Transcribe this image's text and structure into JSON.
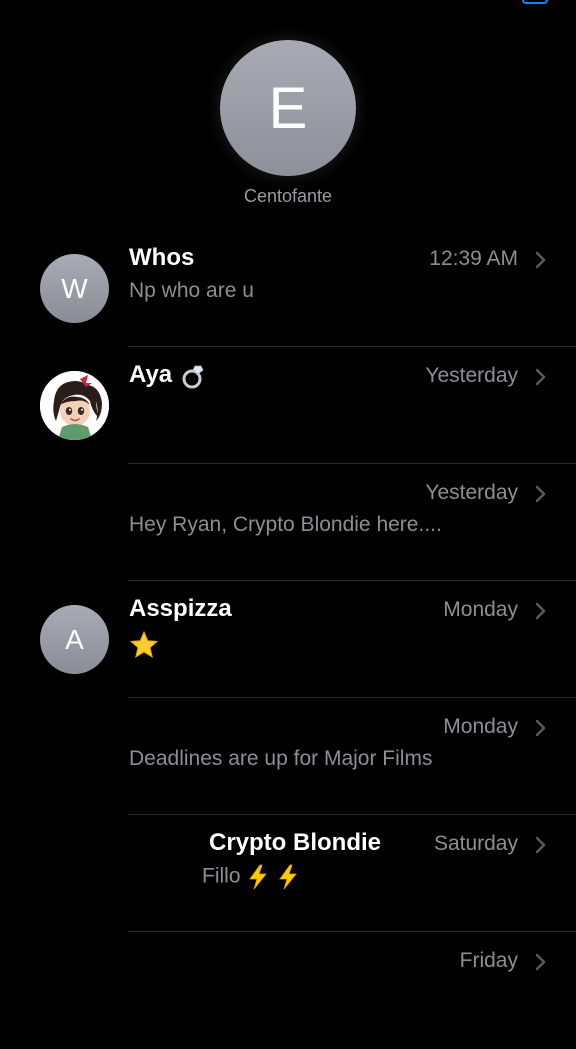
{
  "pinned": {
    "initial": "E",
    "name": "Centofante"
  },
  "conversations": [
    {
      "avatar_initial": "W",
      "name": "Whos",
      "time": "12:39 AM",
      "preview": "Np who are u"
    },
    {
      "avatar_initial": "",
      "name": "Aya",
      "name_icon": "ring-icon",
      "time": "Yesterday",
      "preview": ""
    },
    {
      "avatar_initial": "",
      "name": "",
      "time": "Yesterday",
      "preview": "Hey Ryan, Crypto Blondie here...."
    },
    {
      "avatar_initial": "A",
      "name": "Asspizza",
      "time": "Monday",
      "preview_icon": "star-icon"
    },
    {
      "avatar_initial": "",
      "name": "",
      "time": "Monday",
      "preview": "Deadlines are up for Major Films"
    },
    {
      "avatar_initial": "",
      "name": "Crypto Blondie",
      "time": "Saturday",
      "preview": "Fillo",
      "preview_icon": "lightning-icon"
    },
    {
      "avatar_initial": "",
      "name": "",
      "time": "Friday",
      "preview": ""
    }
  ],
  "colors": {
    "background": "#000000",
    "accent": "#0a84ff",
    "secondary_text": "#8e8e93",
    "divider": "#2c2c2e"
  }
}
